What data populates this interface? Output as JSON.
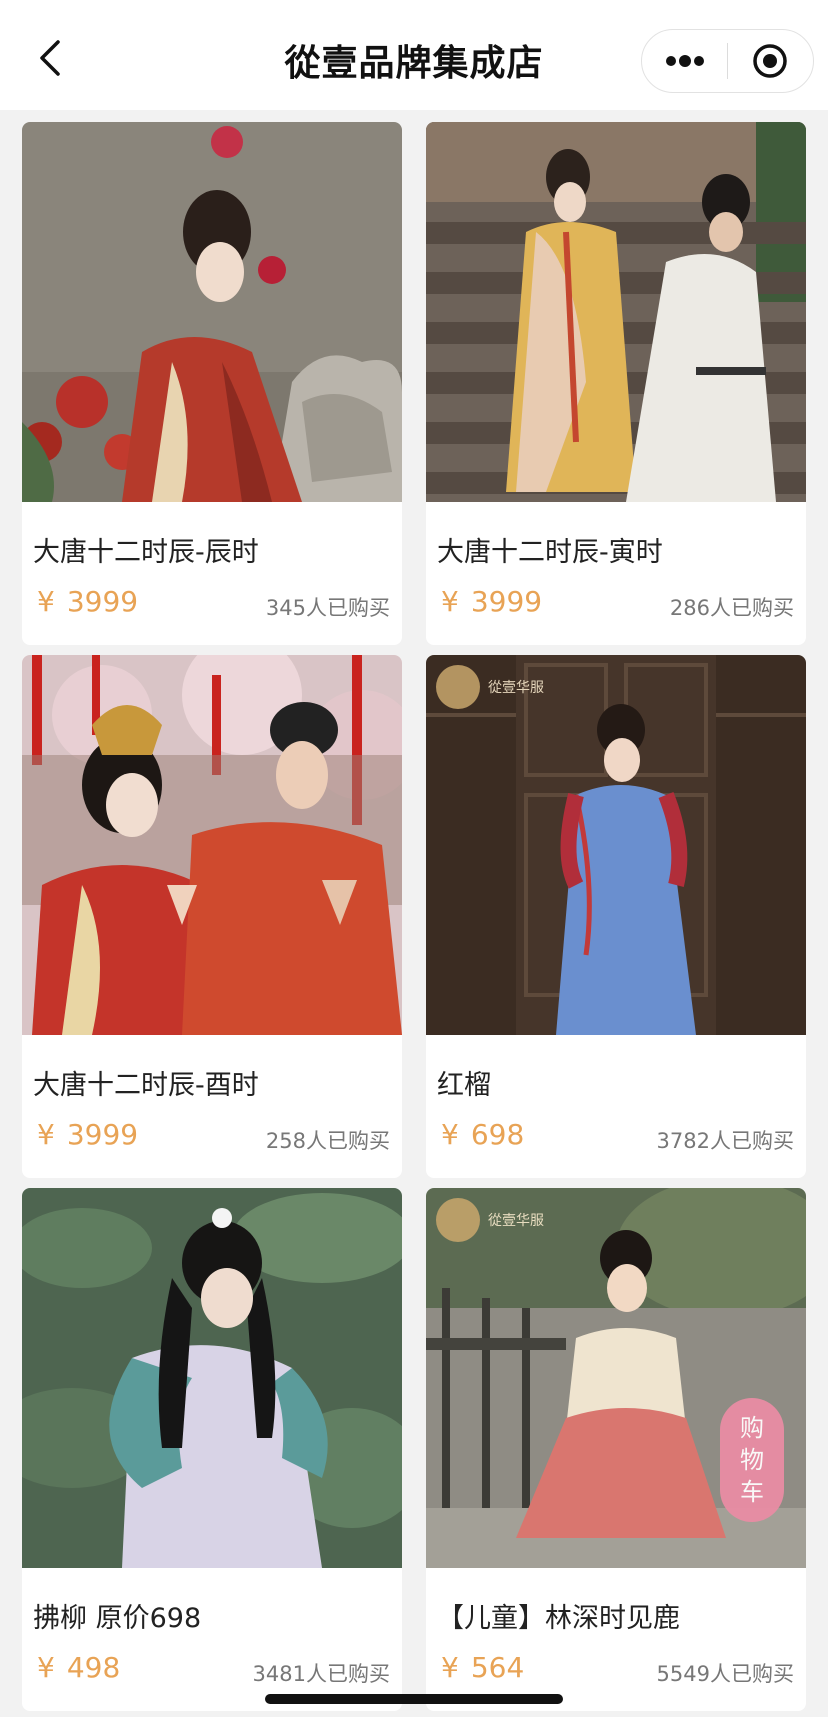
{
  "nav": {
    "title": "從壹品牌集成店",
    "back_icon": "chevron-left-icon",
    "more_icon": "more-dots-icon",
    "target_icon": "close-target-icon"
  },
  "products": [
    {
      "name": "大唐十二时辰-辰时",
      "currency": "¥",
      "price": "3999",
      "sold": "345人已购买"
    },
    {
      "name": "大唐十二时辰-寅时",
      "currency": "¥",
      "price": "3999",
      "sold": "286人已购买"
    },
    {
      "name": "大唐十二时辰-酉时",
      "currency": "¥",
      "price": "3999",
      "sold": "258人已购买"
    },
    {
      "name": "红榴",
      "currency": "¥",
      "price": "698",
      "sold": "3782人已购买"
    },
    {
      "name": "拂柳 原价698",
      "currency": "¥",
      "price": "498",
      "sold": "3481人已购买"
    },
    {
      "name": "【儿童】林深时见鹿",
      "currency": "¥",
      "price": "564",
      "sold": "5549人已购买"
    }
  ],
  "watermarks": [
    "從壹华服",
    "從壹华服"
  ],
  "cart": {
    "chars": [
      "购",
      "物",
      "车"
    ]
  },
  "colors": {
    "price": "#e8a355",
    "cart": "#e98da4",
    "background": "#f2f2f2"
  }
}
